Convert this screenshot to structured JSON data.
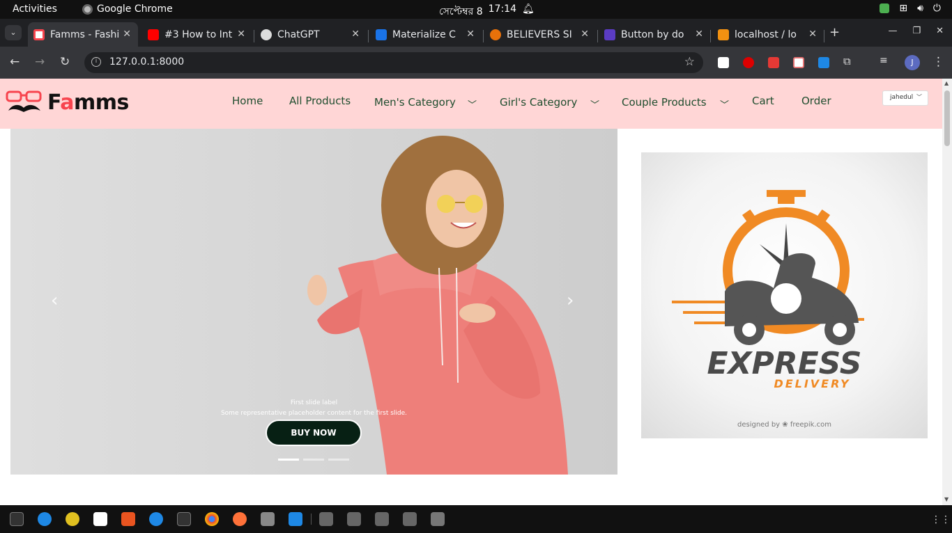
{
  "os": {
    "activities": "Activities",
    "app_name": "Google Chrome",
    "date": "সেপ্টেম্বর 8",
    "time": "17:14"
  },
  "tabs": [
    {
      "title": "Famms - Fashi",
      "active": true,
      "favicon_color": "#f7444e"
    },
    {
      "title": "#3 How to Int",
      "active": false,
      "favicon_color": "#ff0000"
    },
    {
      "title": "ChatGPT",
      "active": false,
      "favicon_color": "#cccccc"
    },
    {
      "title": "Materialize C",
      "active": false,
      "favicon_color": "#1a73e8"
    },
    {
      "title": "BELIEVERS SI",
      "active": false,
      "favicon_color": "#e8710a"
    },
    {
      "title": "Button by do",
      "active": false,
      "favicon_color": "#5b3cc4"
    },
    {
      "title": "localhost / lo",
      "active": false,
      "favicon_color": "#f29111"
    }
  ],
  "browser": {
    "url": "127.0.0.1:8000",
    "profile_initial": "J"
  },
  "site": {
    "logo_prefix": "F",
    "logo_accent": "a",
    "logo_suffix": "mms",
    "nav": {
      "home": "Home",
      "all_products": "All Products",
      "mens": "Men's Category",
      "girls": "Girl's Category",
      "couple": "Couple Products",
      "cart": "Cart",
      "order": "Order"
    },
    "user": "jahedul",
    "colors": {
      "header_bg": "#ffd6d6",
      "nav_text": "#1f4d2e",
      "accent": "#f7444e"
    }
  },
  "carousel": {
    "caption_title": "First slide label",
    "caption_text": "Some representative placeholder content for the first slide.",
    "button_label": "BUY NOW",
    "active_slide": 1,
    "slide_count": 3
  },
  "delivery_image": {
    "headline": "EXPRESS",
    "subline": "DELIVERY",
    "credit": "designed by ❀ freepik.com"
  }
}
